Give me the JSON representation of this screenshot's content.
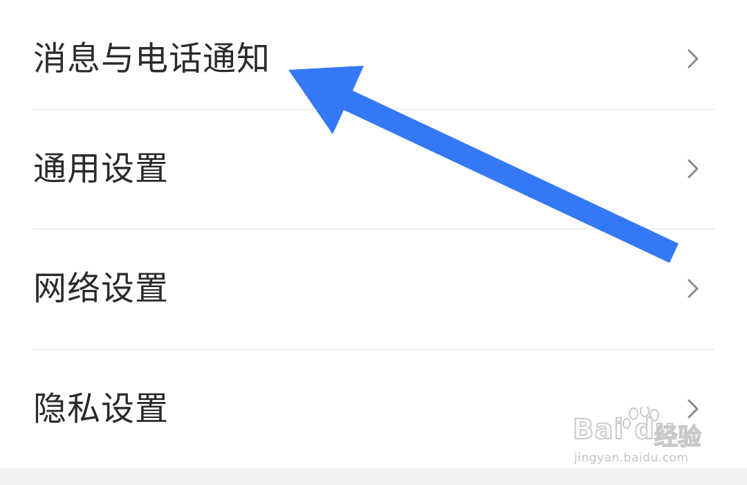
{
  "settings": {
    "items": [
      {
        "id": "message-call-notifications",
        "label": "消息与电话通知"
      },
      {
        "id": "general-settings",
        "label": "通用设置"
      },
      {
        "id": "network-settings",
        "label": "网络设置"
      },
      {
        "id": "privacy-settings",
        "label": "隐私设置"
      }
    ]
  },
  "annotation": {
    "arrow_color": "#3478f6",
    "arrow_icon": "pointer-arrow"
  },
  "watermark": {
    "brand": "Bai du",
    "brand_cn": "经验",
    "url": "jingyan.baidu.com"
  },
  "colors": {
    "label_text": "#2b2b2b",
    "chevron": "#8a8a8a",
    "divider": "#eeeeee",
    "background": "#ffffff",
    "bottom_band": "#f2f2f2"
  }
}
